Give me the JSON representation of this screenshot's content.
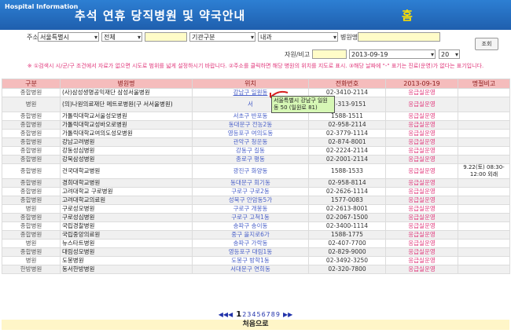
{
  "header": {
    "brand": "Hospital Information",
    "title": "추석 연휴 당직병원 및 약국안내",
    "home": "홈"
  },
  "search": {
    "addr_label": "주소",
    "city": "서울특별시",
    "district": "전체",
    "dong": "",
    "org_type": "기관구분",
    "dept": "내과",
    "name_label": "병원명",
    "name_value": "",
    "button": "조회",
    "subject_label": "자원/비고",
    "subject_value": "",
    "date": "2013-09-19",
    "rows": "20"
  },
  "notice": "※ ①검색시 시/군/구 조건에서 자료가 없으면 시도로 범위를 넓게 설정하시기 바랍니다. ②주소를 클릭하면 해당 병원의 위치를 지도로 표시. ③해당 날짜에 \"-\" 표기는 진료(운영)가 없다는 표기입니다.",
  "table": {
    "headers": [
      "구분",
      "병원명",
      "위치",
      "전화번호",
      "2013-09-19",
      "명절비고"
    ],
    "rows": [
      {
        "type": "종합병원",
        "name": "(사)삼성생명공익재단 삼성서울병원",
        "loc": "강남구 일원동",
        "tel": "02-3410-2114",
        "stat": "응급실운영",
        "memo": ""
      },
      {
        "type": "병원",
        "name": "(의)나원의료재단 메트로병원(구 서서울병원)",
        "loc": "서",
        "tel": "02-313-9151",
        "stat": "응급실운영",
        "memo": "",
        "tall": true
      },
      {
        "type": "종합병원",
        "name": "가톨릭대학교서울성모병원",
        "loc": "서초구 반포동",
        "tel": "1588-1511",
        "stat": "응급실운영",
        "memo": ""
      },
      {
        "type": "종합병원",
        "name": "가톨릭대학교성바오로병원",
        "loc": "동대문구 전농2동",
        "tel": "02-958-2114",
        "stat": "응급실운영",
        "memo": ""
      },
      {
        "type": "종합병원",
        "name": "가톨릭대학교여의도성모병원",
        "loc": "영등포구 여의도동",
        "tel": "02-3779-1114",
        "stat": "응급실운영",
        "memo": ""
      },
      {
        "type": "종합병원",
        "name": "강남고려병원",
        "loc": "관악구 청운동",
        "tel": "02-874-8001",
        "stat": "응급실운영",
        "memo": ""
      },
      {
        "type": "종합병원",
        "name": "강동성심병원",
        "loc": "강동구 길동",
        "tel": "02-2224-2114",
        "stat": "응급실운영",
        "memo": ""
      },
      {
        "type": "종합병원",
        "name": "강북삼성병원",
        "loc": "종로구 평동",
        "tel": "02-2001-2114",
        "stat": "응급실운영",
        "memo": ""
      },
      {
        "type": "종합병원",
        "name": "건국대학교병원",
        "loc": "광진구 화양동",
        "tel": "1588-1533",
        "stat": "응급실운영",
        "memo": "9.22(토) 08:30-12:00 외래",
        "tall": true
      },
      {
        "type": "종합병원",
        "name": "경희대학교병원",
        "loc": "동대문구 회기동",
        "tel": "02-958-8114",
        "stat": "응급실운영",
        "memo": ""
      },
      {
        "type": "종합병원",
        "name": "고려대학교 구로병원",
        "loc": "구로구 구로2동",
        "tel": "02-2626-1114",
        "stat": "응급실운영",
        "memo": ""
      },
      {
        "type": "종합병원",
        "name": "고려대학교의료원",
        "loc": "성북구 안암동5가",
        "tel": "1577-0083",
        "stat": "응급실운영",
        "memo": ""
      },
      {
        "type": "병원",
        "name": "구로성모병원",
        "loc": "구로구 개봉동",
        "tel": "02-2613-8001",
        "stat": "응급실운영",
        "memo": ""
      },
      {
        "type": "종합병원",
        "name": "구로성심병원",
        "loc": "구로구 고척1동",
        "tel": "02-2067-1500",
        "stat": "응급실운영",
        "memo": ""
      },
      {
        "type": "종합병원",
        "name": "국립경찰병원",
        "loc": "송파구 송이동",
        "tel": "02-3400-1114",
        "stat": "응급실운영",
        "memo": ""
      },
      {
        "type": "종합병원",
        "name": "국립중앙의료원",
        "loc": "중구 을지로6가",
        "tel": "1588-1775",
        "stat": "응급실운영",
        "memo": ""
      },
      {
        "type": "병원",
        "name": "뉴스타트병원",
        "loc": "송파구 가락동",
        "tel": "02-407-7700",
        "stat": "응급실운영",
        "memo": ""
      },
      {
        "type": "종합병원",
        "name": "대림성모병원",
        "loc": "영등포구 대림1동",
        "tel": "02-829-9000",
        "stat": "응급실운영",
        "memo": ""
      },
      {
        "type": "병원",
        "name": "도봉병원",
        "loc": "도봉구 방학1동",
        "tel": "02-3492-3250",
        "stat": "응급실운영",
        "memo": ""
      },
      {
        "type": "한방병원",
        "name": "동서한방병원",
        "loc": "서대문구 연희동",
        "tel": "02-320-7800",
        "stat": "응급실운영",
        "memo": ""
      }
    ]
  },
  "tooltip": "서울특별시 강남구 일원동 50 (일원로 81)",
  "pager": {
    "prev": "◀◀◀",
    "pages": [
      "1",
      "2",
      "3",
      "4",
      "5",
      "6",
      "7",
      "8",
      "9"
    ],
    "current": "1",
    "next": "▶▶"
  },
  "footer": {
    "first": "처음으로"
  }
}
